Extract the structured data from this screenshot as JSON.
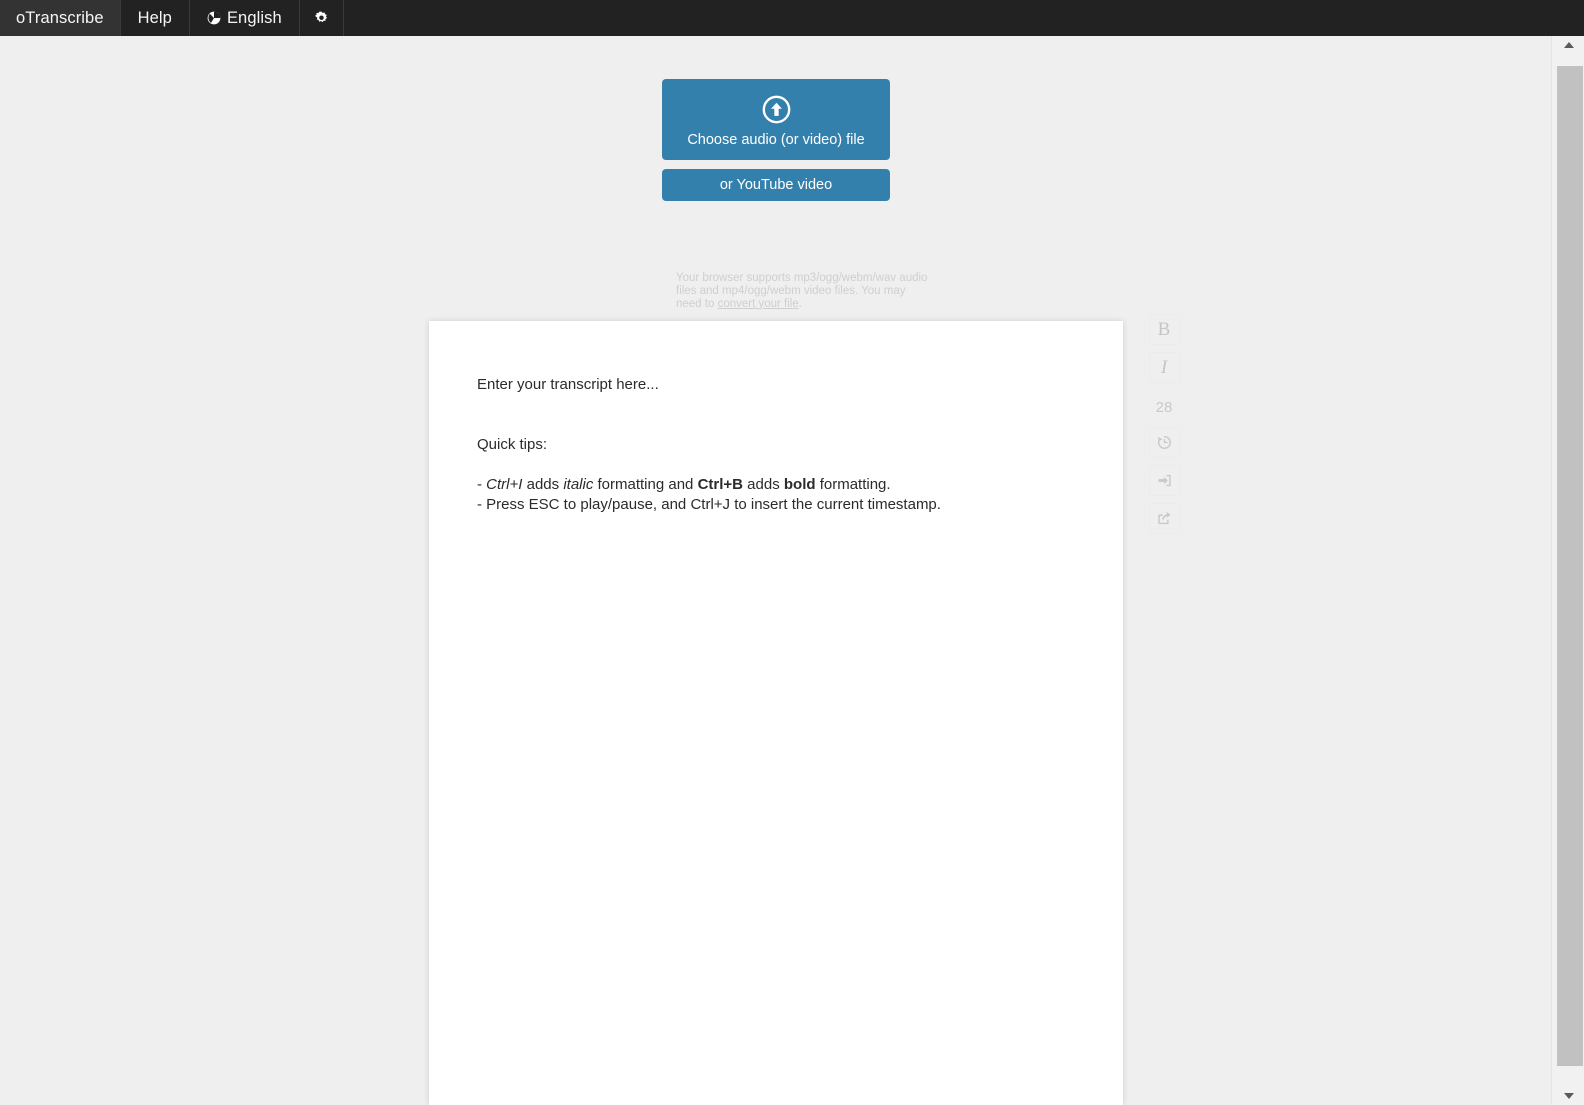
{
  "navbar": {
    "brand": "oTranscribe",
    "help": "Help",
    "language": "English",
    "globe_icon": "globe-icon",
    "gear_icon": "gear-icon"
  },
  "upload": {
    "choose_label": "Choose audio (or video) file",
    "upload_icon": "upload-circle-arrow-up-icon",
    "youtube_label": "or YouTube video",
    "support_note_before": "Your browser supports mp3/ogg/webm/wav audio files and mp4/ogg/webm video files. You may need to ",
    "support_note_link": "convert your file",
    "support_note_after": "."
  },
  "editor": {
    "placeholder_line": "Enter your transcript here...",
    "tips_heading": "Quick tips:",
    "tip1_prefix": "- ",
    "tip1_italic1": "Ctrl+I",
    "tip1_mid1": " adds ",
    "tip1_italic2": "italic",
    "tip1_mid2": " formatting and ",
    "tip1_bold1": "Ctrl+B",
    "tip1_mid3": " adds ",
    "tip1_bold2": "bold",
    "tip1_suffix": " formatting.",
    "tip2": "- Press ESC to play/pause, and Ctrl+J to insert the current timestamp."
  },
  "toolbar": {
    "bold_label": "B",
    "italic_label": "I",
    "word_count": "28",
    "restore_icon": "history-restore-icon",
    "import_icon": "import-arrow-into-box-icon",
    "export_icon": "export-share-icon"
  },
  "colors": {
    "accent": "#3380ad",
    "navbar": "#222222",
    "navbar_active": "#333333",
    "page_bg": "#efefef",
    "panel_bg": "#ffffff"
  }
}
